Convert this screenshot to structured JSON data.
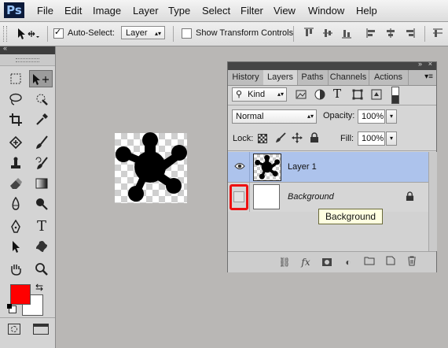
{
  "app": {
    "logo": "Ps"
  },
  "menu": [
    "File",
    "Edit",
    "Image",
    "Layer",
    "Type",
    "Select",
    "Filter",
    "View",
    "Window",
    "Help"
  ],
  "options": {
    "move_icon": "move-tool-icon",
    "auto_select_label": "Auto-Select:",
    "auto_select_checked": true,
    "auto_select_target": "Layer",
    "show_transform_label": "Show Transform Controls",
    "show_transform_checked": false
  },
  "layers_panel": {
    "tabs": [
      "History",
      "Layers",
      "Paths",
      "Channels",
      "Actions"
    ],
    "active_tab": "Layers",
    "filter_kind": "Kind",
    "blend_mode": "Normal",
    "opacity_label": "Opacity:",
    "opacity_value": "100%",
    "lock_label": "Lock:",
    "fill_label": "Fill:",
    "fill_value": "100%",
    "layers": [
      {
        "name": "Layer 1",
        "visible": true,
        "selected": true
      },
      {
        "name": "Background",
        "visible": false,
        "selected": false,
        "locked": true
      }
    ]
  },
  "tooltip": "Background",
  "colors": {
    "foreground": "#ff0000",
    "background": "#ffffff",
    "highlight": "#ee1111",
    "selected_layer": "#adc3ec"
  }
}
